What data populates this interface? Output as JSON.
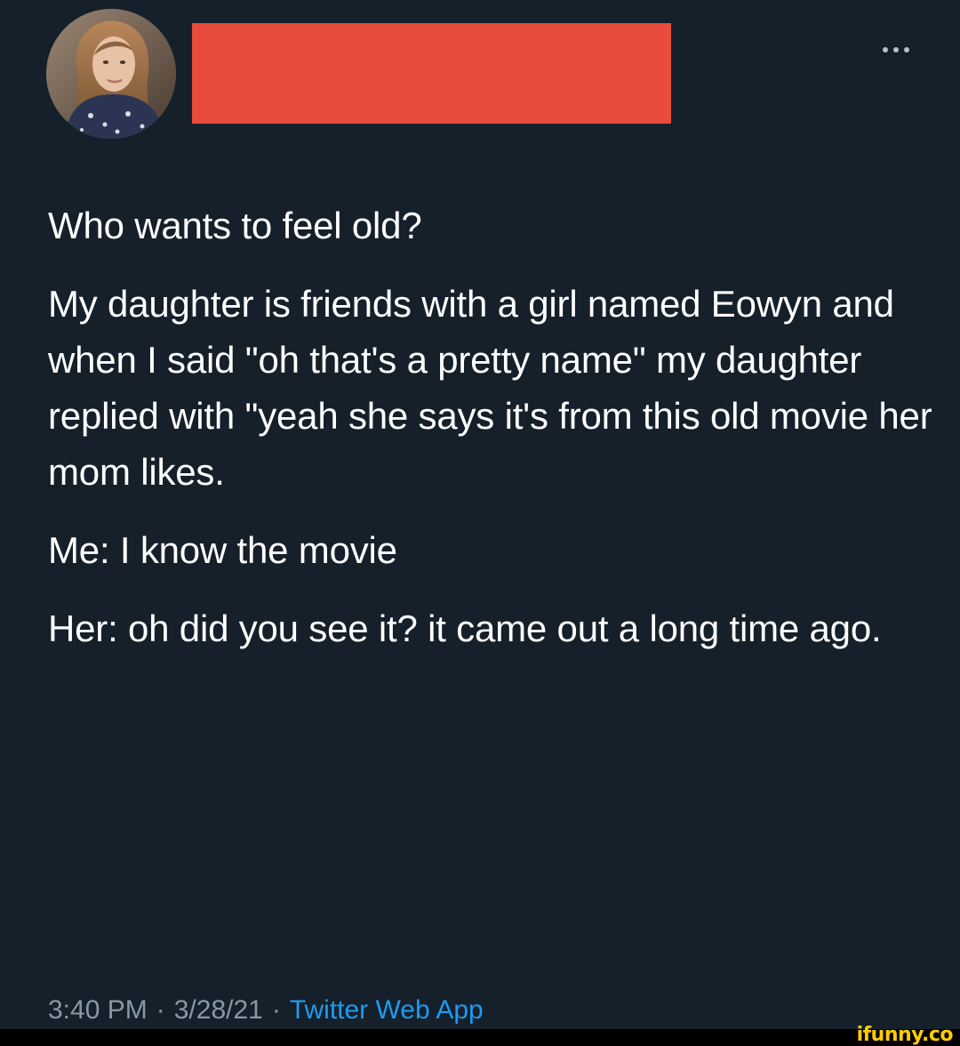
{
  "tweet": {
    "paragraphs": [
      "Who wants to feel old?",
      "My daughter is friends with a girl named Eowyn and when I said \"oh that's a pretty name\" my daughter replied with \"yeah she says it's from this old movie her mom likes.",
      "Me: I know the movie",
      "Her: oh did you see it? it came out a long time ago."
    ],
    "time": "3:40 PM",
    "date": "3/28/21",
    "source": "Twitter Web App",
    "separator": "·"
  },
  "watermark": "ifunny.co",
  "colors": {
    "background": "#15202b",
    "redaction": "#e74c3c",
    "meta_text": "#8899a6",
    "link": "#1d9bf0",
    "watermark": "#ffcc00"
  },
  "icons": {
    "more": "more-dots-icon",
    "avatar": "profile-avatar"
  }
}
